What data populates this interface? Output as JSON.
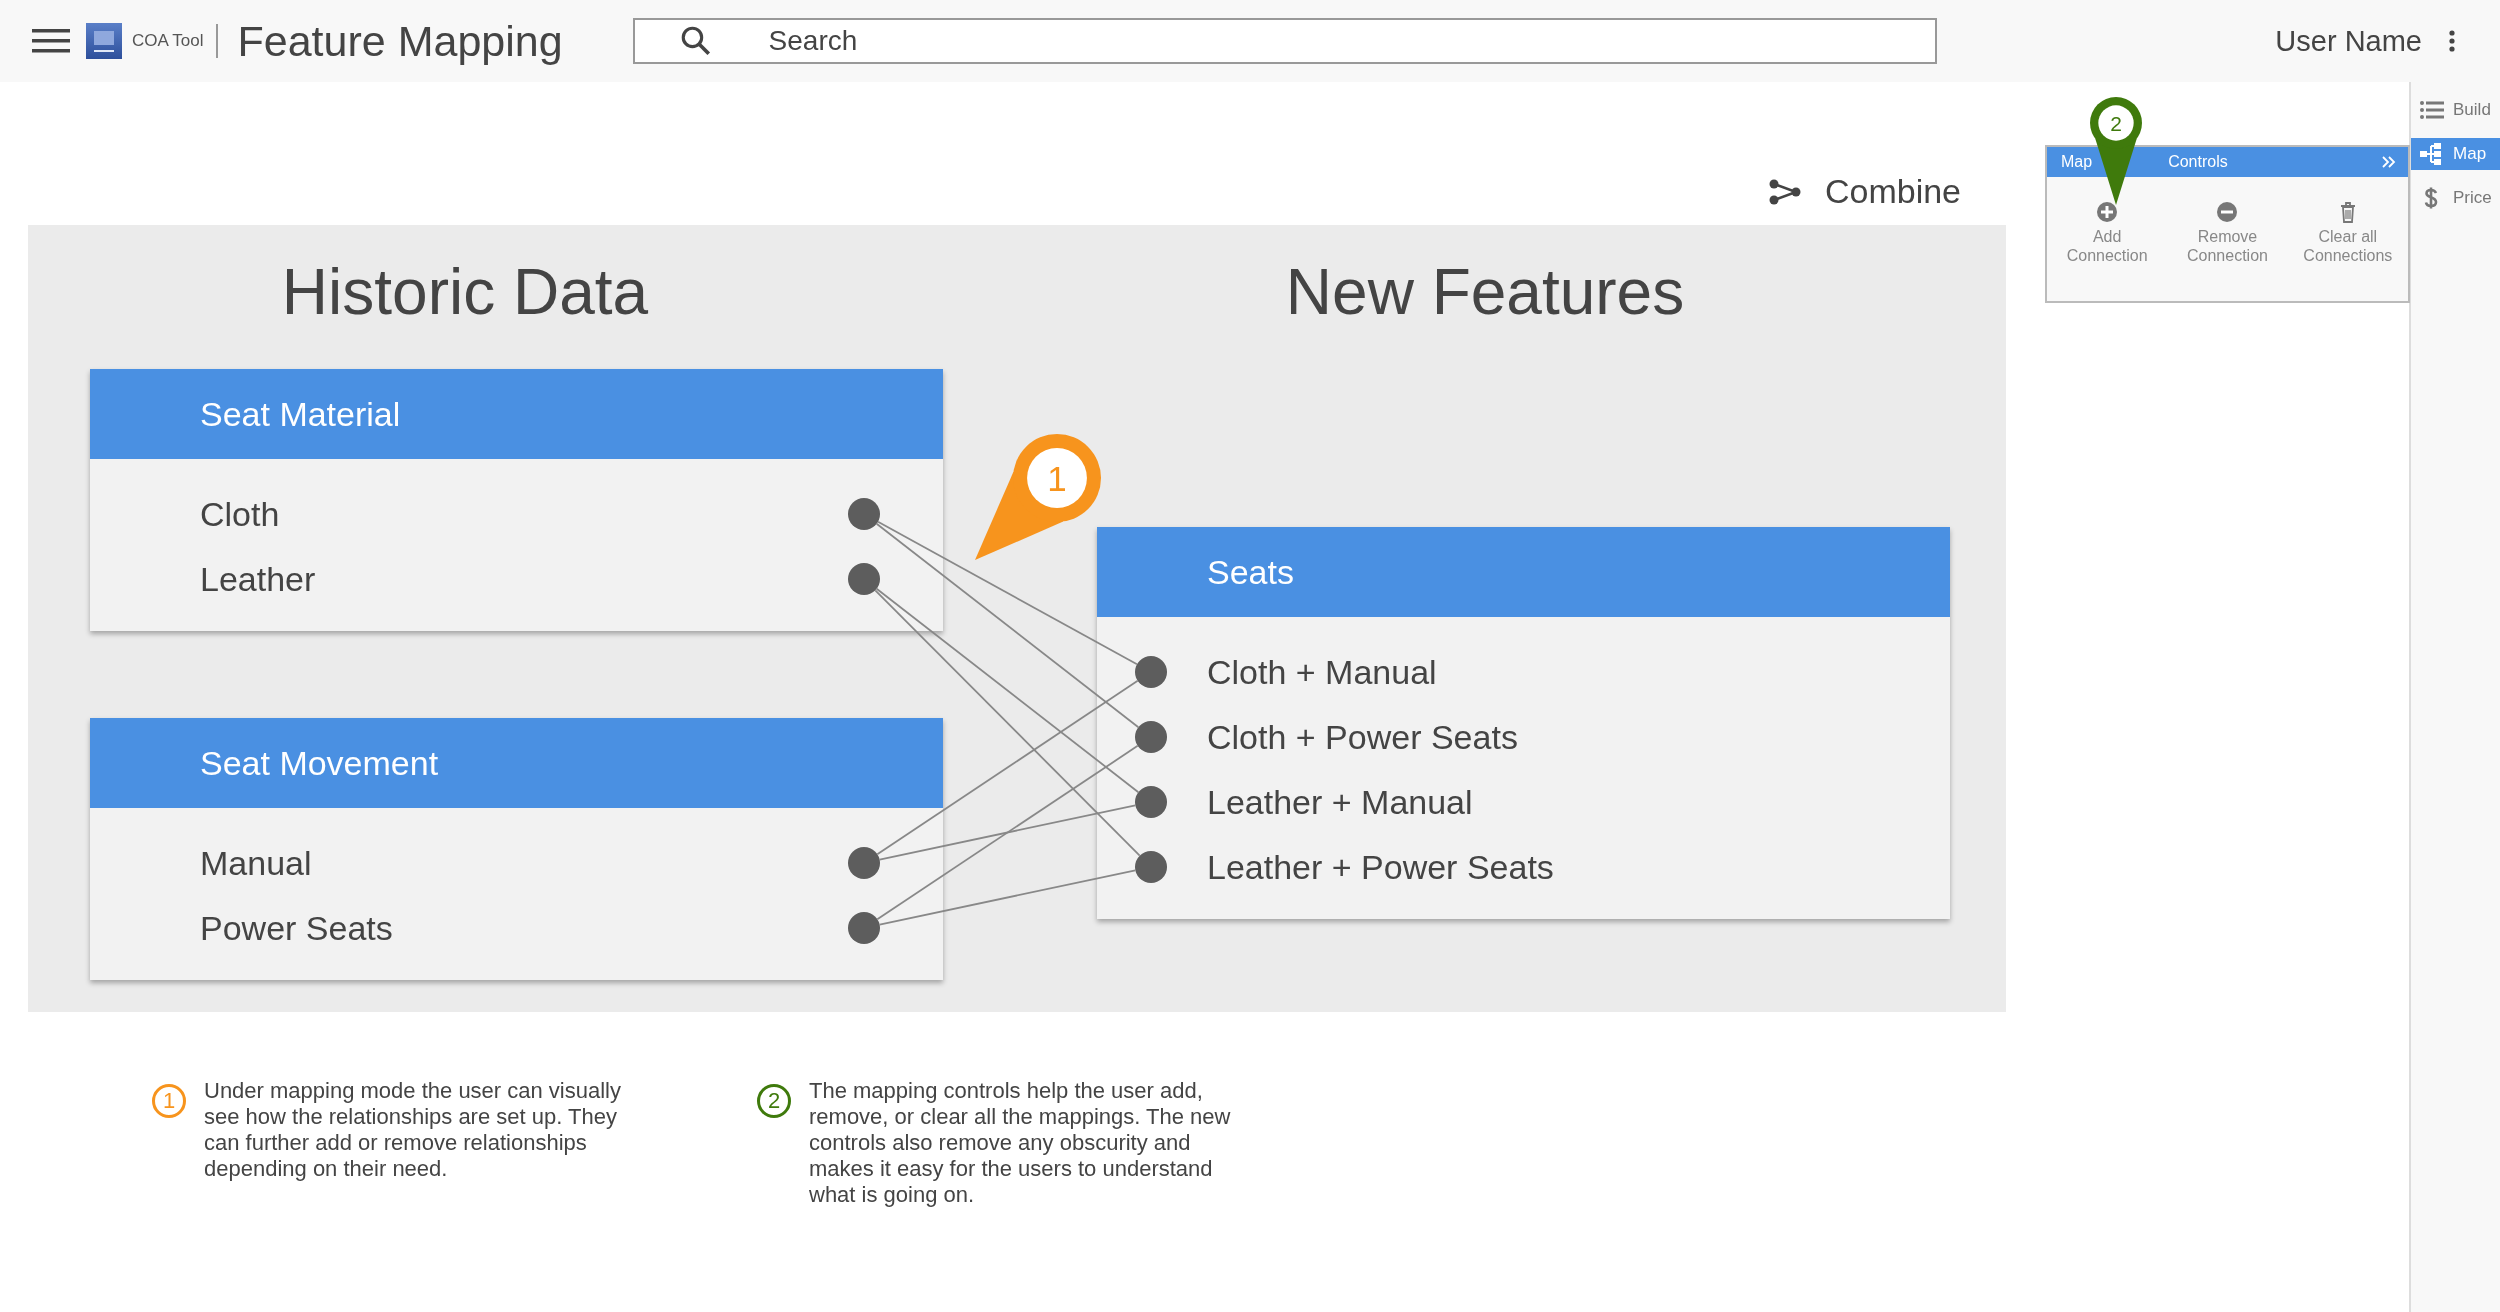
{
  "header": {
    "app_name": "COA Tool",
    "title": "Feature Mapping",
    "search": {
      "placeholder": "Search"
    },
    "user": "User Name"
  },
  "combine": {
    "label": "Combine"
  },
  "canvas": {
    "left_title": "Historic Data",
    "right_title": "New Features",
    "source_groups": [
      {
        "title": "Seat Material",
        "items": [
          {
            "label": "Cloth",
            "links": [
              true,
              true,
              false,
              false
            ]
          },
          {
            "label": "Leather",
            "links": [
              false,
              false,
              true,
              true
            ]
          }
        ]
      },
      {
        "title": "Seat Movement",
        "items": [
          {
            "label": "Manual",
            "links": [
              true,
              false,
              true,
              false
            ]
          },
          {
            "label": "Power Seats",
            "links": [
              false,
              true,
              false,
              true
            ]
          }
        ]
      }
    ],
    "target_group": {
      "title": "Seats",
      "items": [
        {
          "label": "Cloth + Manual"
        },
        {
          "label": "Cloth + Power Seats"
        },
        {
          "label": "Leather + Manual"
        },
        {
          "label": "Leather + Power Seats"
        }
      ]
    }
  },
  "controls_panel": {
    "title_parts": [
      "Map",
      "Controls"
    ],
    "buttons": [
      {
        "kind": "add",
        "label": "Add Connection"
      },
      {
        "kind": "remove",
        "label": "Remove Connection"
      },
      {
        "kind": "clear",
        "label": "Clear all Connections"
      }
    ]
  },
  "sidebar": {
    "items": [
      {
        "kind": "build",
        "label": "Build",
        "selected": false
      },
      {
        "kind": "map",
        "label": "Map",
        "selected": true
      },
      {
        "kind": "price",
        "label": "Price",
        "selected": false
      }
    ]
  },
  "callouts": [
    {
      "pin_label": "1",
      "note_label": "1",
      "color": "#f7941d",
      "note": "Under mapping mode the user can visually see how the relationships are set up. They can further add or remove relationships depending on their need."
    },
    {
      "pin_label": "2",
      "note_label": "2",
      "color": "#3f7a0c",
      "note": "The mapping controls help the user add, remove, or clear all the mappings. The new controls also remove any obscurity and makes it easy for the users to understand what is going on."
    }
  ]
}
